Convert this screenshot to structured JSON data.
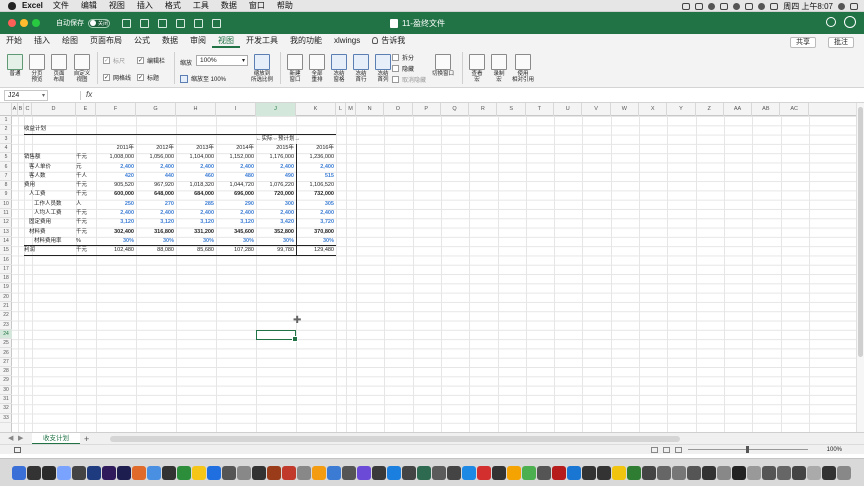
{
  "menubar": {
    "app": "Excel",
    "items": [
      "文件",
      "编辑",
      "视图",
      "插入",
      "格式",
      "工具",
      "数据",
      "窗口",
      "帮助"
    ],
    "datetime": "周四 上午8:07"
  },
  "titlebar": {
    "autosave_label": "自动保存",
    "autosave_state": "关闭",
    "doc_title": "11-盈终文件"
  },
  "tabs": [
    "开始",
    "插入",
    "绘图",
    "页面布局",
    "公式",
    "数据",
    "审阅",
    "视图",
    "开发工具",
    "我的功能",
    "xlwings",
    "告诉我"
  ],
  "active_tab": "视图",
  "share_label": "共享",
  "comment_label": "批注",
  "ribbon": {
    "normal": "普通",
    "page_break": "分页\n预览",
    "page_layout": "页面\n布局",
    "custom_view": "自定义\n视图",
    "ruler": "标尺",
    "formula_bar": "编辑栏",
    "gridlines": "网格线",
    "headings": "标题",
    "zoom_label": "缩放",
    "zoom_value": "100%",
    "zoom_100": "缩放至 100%",
    "zoom_selection": "缩放到\n所选比例",
    "new_window": "新建\n窗口",
    "arrange_all": "全部\n重排",
    "freeze_panes": "冻结\n窗格",
    "freeze_top_row": "冻结\n首行",
    "freeze_first_col": "冻结\n首列",
    "split": "拆分",
    "hide": "隐藏",
    "unhide": "取消隐藏",
    "switch_windows": "切换窗口",
    "view_macros": "查看\n宏",
    "record_macro": "录制\n宏",
    "relative_ref": "使用\n相对引用"
  },
  "formula_bar": {
    "name_box": "J24",
    "fx": "fx",
    "value": ""
  },
  "columns": [
    "A",
    "B",
    "C",
    "D",
    "E",
    "F",
    "G",
    "H",
    "I",
    "J",
    "K",
    "L",
    "M",
    "N",
    "O",
    "P",
    "Q",
    "R",
    "S",
    "T",
    "U",
    "V",
    "W",
    "X",
    "Y",
    "Z",
    "AA",
    "AB",
    "AC"
  ],
  "selected_column": "J",
  "rows": [
    "1",
    "2",
    "3",
    "4",
    "5",
    "6",
    "7",
    "8",
    "9",
    "10",
    "11",
    "12",
    "13",
    "14",
    "15",
    "16",
    "17",
    "18",
    "19",
    "20",
    "21",
    "22",
    "23",
    "24",
    "25",
    "26",
    "27",
    "28",
    "29",
    "30",
    "31",
    "32",
    "33"
  ],
  "selected_row": "24",
  "sheet": {
    "title": "收益计划",
    "actual_plan_label": "←实际⇔预计划→",
    "years": [
      "2011年",
      "2012年",
      "2013年",
      "2014年",
      "2015年",
      "2016年"
    ],
    "lines": [
      {
        "label": "销售额",
        "indent": 0,
        "unit": "千元",
        "values": [
          "1,008,000",
          "1,056,000",
          "1,104,000",
          "1,152,000",
          "1,176,000",
          "1,236,000"
        ],
        "blue": false,
        "bold": false
      },
      {
        "label": "客人单价",
        "indent": 1,
        "unit": "元",
        "values": [
          "2,400",
          "2,400",
          "2,400",
          "2,400",
          "2,400",
          "2,400"
        ],
        "blue": true,
        "bold": true
      },
      {
        "label": "客人数",
        "indent": 1,
        "unit": "千人",
        "values": [
          "420",
          "440",
          "460",
          "480",
          "490",
          "515"
        ],
        "blue": true,
        "bold": true
      },
      {
        "label": "费用",
        "indent": 0,
        "unit": "千元",
        "values": [
          "905,520",
          "967,920",
          "1,018,320",
          "1,044,720",
          "1,076,220",
          "1,106,520"
        ],
        "blue": false,
        "bold": false
      },
      {
        "label": "人工费",
        "indent": 1,
        "unit": "千元",
        "values": [
          "600,000",
          "648,000",
          "684,000",
          "696,000",
          "720,000",
          "732,000"
        ],
        "blue": false,
        "bold": true
      },
      {
        "label": "工作人员数",
        "indent": 2,
        "unit": "人",
        "values": [
          "250",
          "270",
          "285",
          "290",
          "300",
          "305"
        ],
        "blue": true,
        "bold": true
      },
      {
        "label": "人均人工费",
        "indent": 2,
        "unit": "千元",
        "values": [
          "2,400",
          "2,400",
          "2,400",
          "2,400",
          "2,400",
          "2,400"
        ],
        "blue": true,
        "bold": true
      },
      {
        "label": "固定费用",
        "indent": 1,
        "unit": "千元",
        "values": [
          "3,120",
          "3,120",
          "3,120",
          "3,120",
          "3,420",
          "3,720"
        ],
        "blue": true,
        "bold": true
      },
      {
        "label": "材料费",
        "indent": 1,
        "unit": "千元",
        "values": [
          "302,400",
          "316,800",
          "331,200",
          "345,600",
          "352,800",
          "370,800"
        ],
        "blue": false,
        "bold": true
      },
      {
        "label": "材料费用率",
        "indent": 2,
        "unit": "%",
        "values": [
          "30%",
          "30%",
          "30%",
          "30%",
          "30%",
          "30%"
        ],
        "blue": true,
        "bold": true
      },
      {
        "label": "利润",
        "indent": 0,
        "unit": "千元",
        "values": [
          "102,480",
          "88,080",
          "85,680",
          "107,280",
          "99,780",
          "129,480"
        ],
        "blue": false,
        "bold": false
      }
    ]
  },
  "sheet_tab": "收支计划",
  "add_sheet": "+",
  "zoom_status": "100%",
  "colors": {
    "accent": "#217346",
    "input_blue": "#3f7fd5"
  }
}
